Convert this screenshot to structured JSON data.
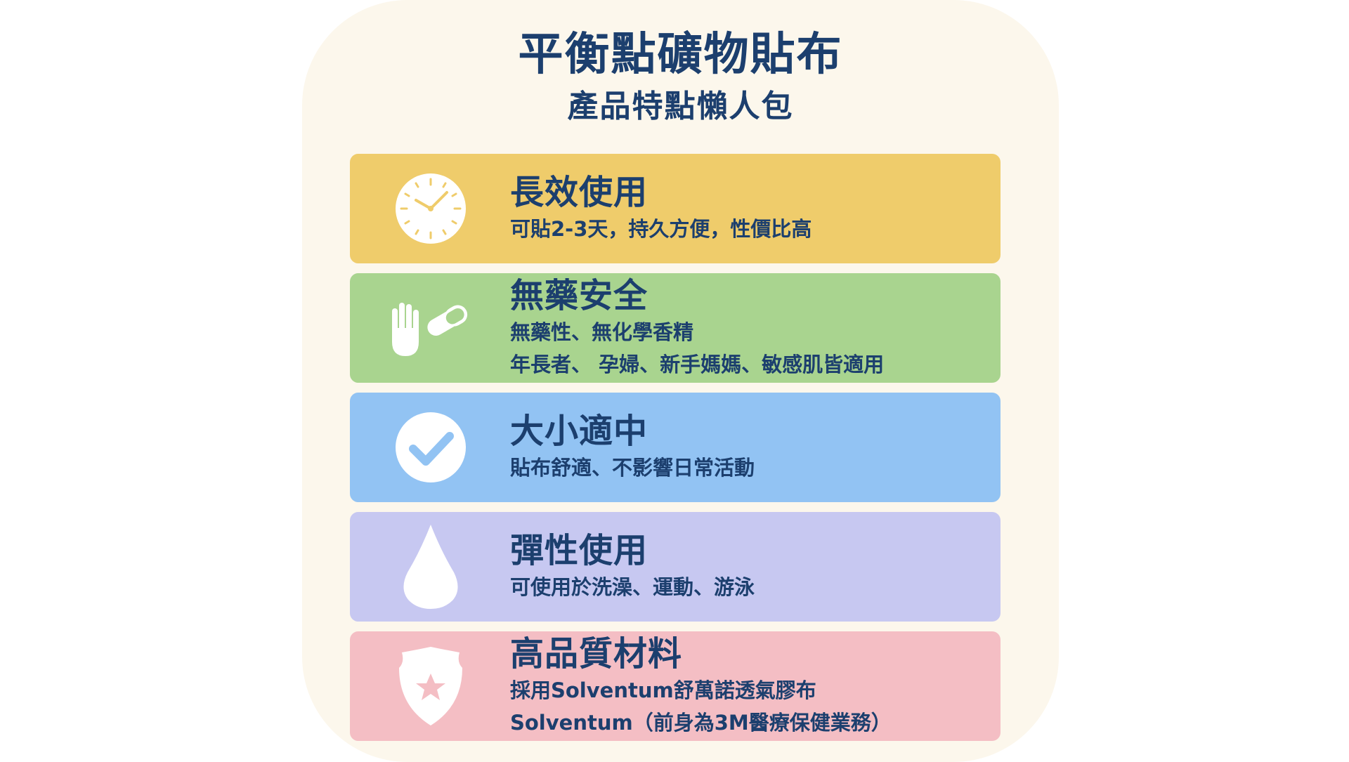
{
  "header": {
    "title": "平衡點礦物貼布",
    "subtitle": "產品特點懶人包"
  },
  "features": [
    {
      "icon": "clock-icon",
      "color": "#efcc6b",
      "heading": "長效使用",
      "lines": [
        "可貼2-3天，持久方便，性價比高"
      ]
    },
    {
      "icon": "hand-pill-icon",
      "color": "#a9d48f",
      "heading": "無藥安全",
      "lines": [
        "無藥性、無化學香精",
        "年長者、 孕婦、新手媽媽、敏感肌皆適用"
      ]
    },
    {
      "icon": "check-circle-icon",
      "color": "#92c3f3",
      "heading": "大小適中",
      "lines": [
        "貼布舒適、不影響日常活動"
      ]
    },
    {
      "icon": "water-drop-icon",
      "color": "#c7c8f1",
      "heading": "彈性使用",
      "lines": [
        "可使用於洗澡、運動、游泳"
      ]
    },
    {
      "icon": "shield-star-icon",
      "color": "#f4bec4",
      "heading": "高品質材料",
      "lines": [
        "採用Solventum舒萬諾透氣膠布",
        "Solventum（前身為3M醫療保健業務）"
      ]
    }
  ]
}
